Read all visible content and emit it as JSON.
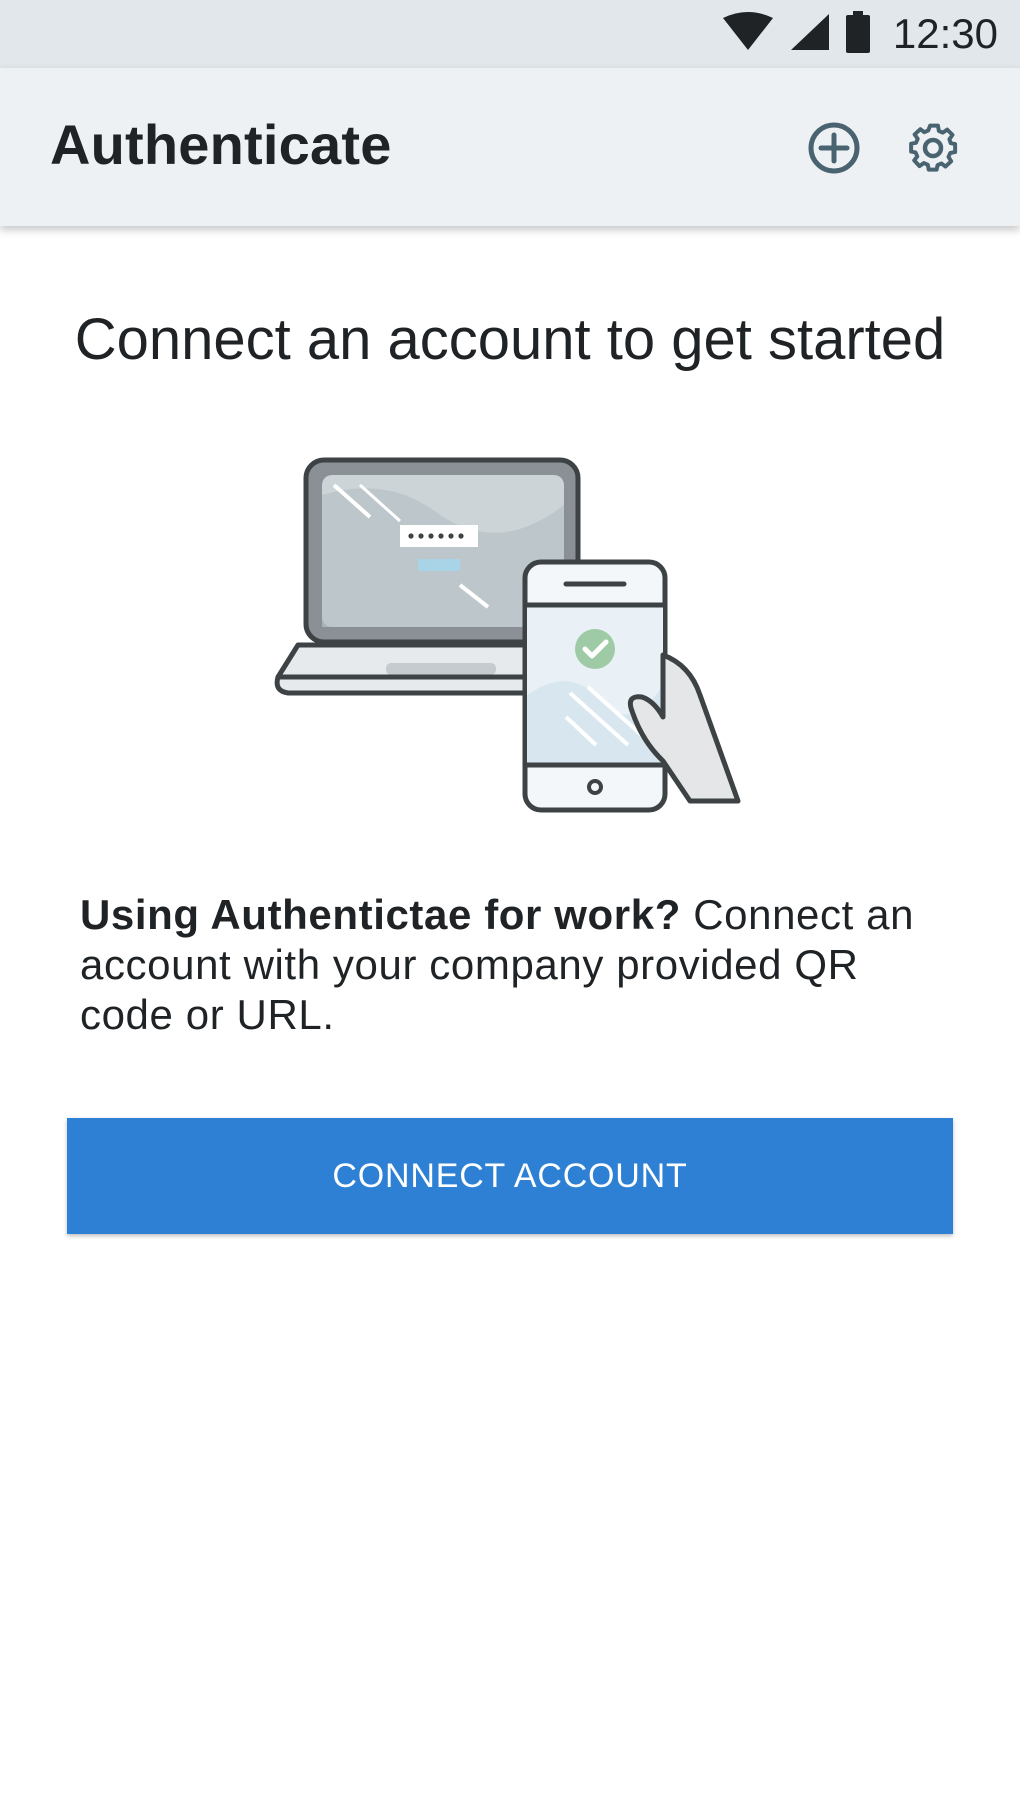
{
  "status_bar": {
    "time": "12:30",
    "icons": [
      "wifi-icon",
      "cellular-signal-icon",
      "battery-icon"
    ]
  },
  "app_bar": {
    "title": "Authenticate",
    "actions": [
      {
        "name": "add-account-button",
        "icon": "plus-circle-icon"
      },
      {
        "name": "settings-button",
        "icon": "gear-icon"
      }
    ],
    "background": "#edf1f3",
    "icon_color": "#4a6370"
  },
  "main": {
    "headline": "Connect an account to get started",
    "illustration": "laptop-and-phone-illustration",
    "description_bold": "Using Authentictae for work?",
    "description_rest": " Connect an account with your company provided QR code or URL.",
    "button_label": "CONNECT ACCOUNT",
    "button_color": "#2e80d4"
  }
}
